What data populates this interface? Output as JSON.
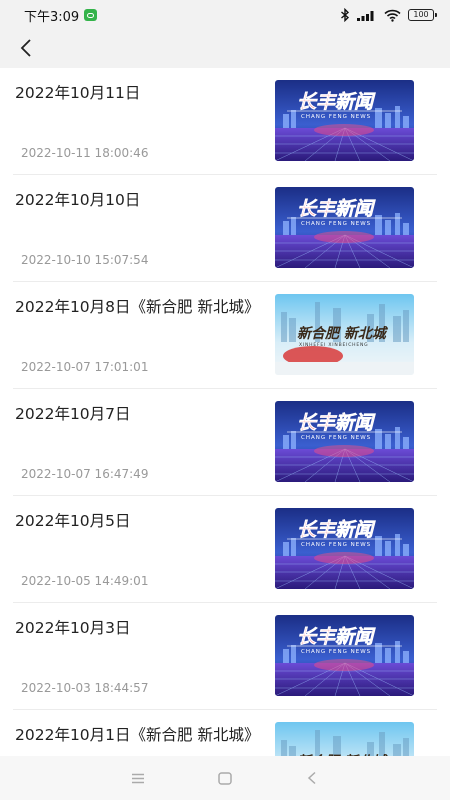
{
  "status_bar": {
    "time": "下午3:09",
    "battery": "100",
    "icons": [
      "wechat-notification-icon",
      "bluetooth-icon",
      "signal-icon",
      "wifi-icon",
      "battery-icon"
    ]
  },
  "nav": {
    "back_icon": "back-arrow-icon"
  },
  "items": [
    {
      "title": "2022年10月11日",
      "time": "2022-10-11 18:00:46",
      "thumb": "changfeng-news"
    },
    {
      "title": "2022年10月10日",
      "time": "2022-10-10 15:07:54",
      "thumb": "changfeng-news"
    },
    {
      "title": "2022年10月8日《新合肥 新北城》",
      "time": "2022-10-07 17:01:01",
      "thumb": "xinhefei-xinbeicheng"
    },
    {
      "title": "2022年10月7日",
      "time": "2022-10-07 16:47:49",
      "thumb": "changfeng-news"
    },
    {
      "title": "2022年10月5日",
      "time": "2022-10-05 14:49:01",
      "thumb": "changfeng-news"
    },
    {
      "title": "2022年10月3日",
      "time": "2022-10-03 18:44:57",
      "thumb": "changfeng-news"
    },
    {
      "title": "2022年10月1日《新合肥 新北城》",
      "time": "",
      "thumb": "xinhefei-xinbeicheng"
    }
  ],
  "thumbs": {
    "changfeng-news": {
      "logo": "长丰新闻",
      "subtitle": "CHANG FENG NEWS"
    },
    "xinhefei-xinbeicheng": {
      "logo": "新合肥 新北城",
      "subtitle": "XINHEFEI XINBEICHENG"
    }
  },
  "system_nav": {
    "icons": [
      "menu-icon",
      "home-icon",
      "back-triangle-icon"
    ]
  },
  "colors": {
    "status_bg": "#f2f2f2",
    "time_text": "#999999",
    "news_logo": "#e8313b",
    "news_bg": "#1f2f8f"
  }
}
